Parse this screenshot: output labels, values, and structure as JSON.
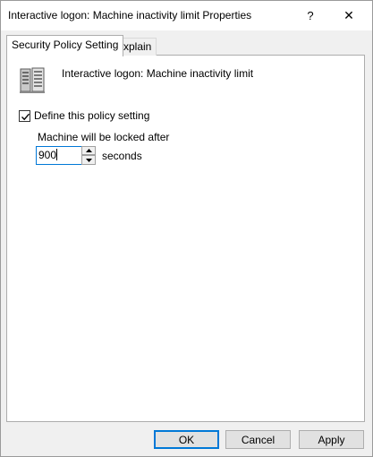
{
  "window": {
    "title": "Interactive logon: Machine inactivity limit Properties",
    "help_label": "?",
    "close_label": "✕"
  },
  "tabs": [
    {
      "label": "Security Policy Setting",
      "active": true
    },
    {
      "label": "Explain",
      "active": false
    }
  ],
  "policy": {
    "icon": "server-computer-icon",
    "name": "Interactive logon: Machine inactivity limit"
  },
  "define_setting": {
    "label": "Define this policy setting",
    "checked": true
  },
  "inactivity": {
    "label": "Machine will be locked after",
    "value": "900",
    "unit": "seconds"
  },
  "buttons": {
    "ok": "OK",
    "cancel": "Cancel",
    "apply": "Apply"
  },
  "colors": {
    "accent": "#0078d7",
    "window_bg": "#f0f0f0",
    "panel_bg": "#ffffff"
  }
}
